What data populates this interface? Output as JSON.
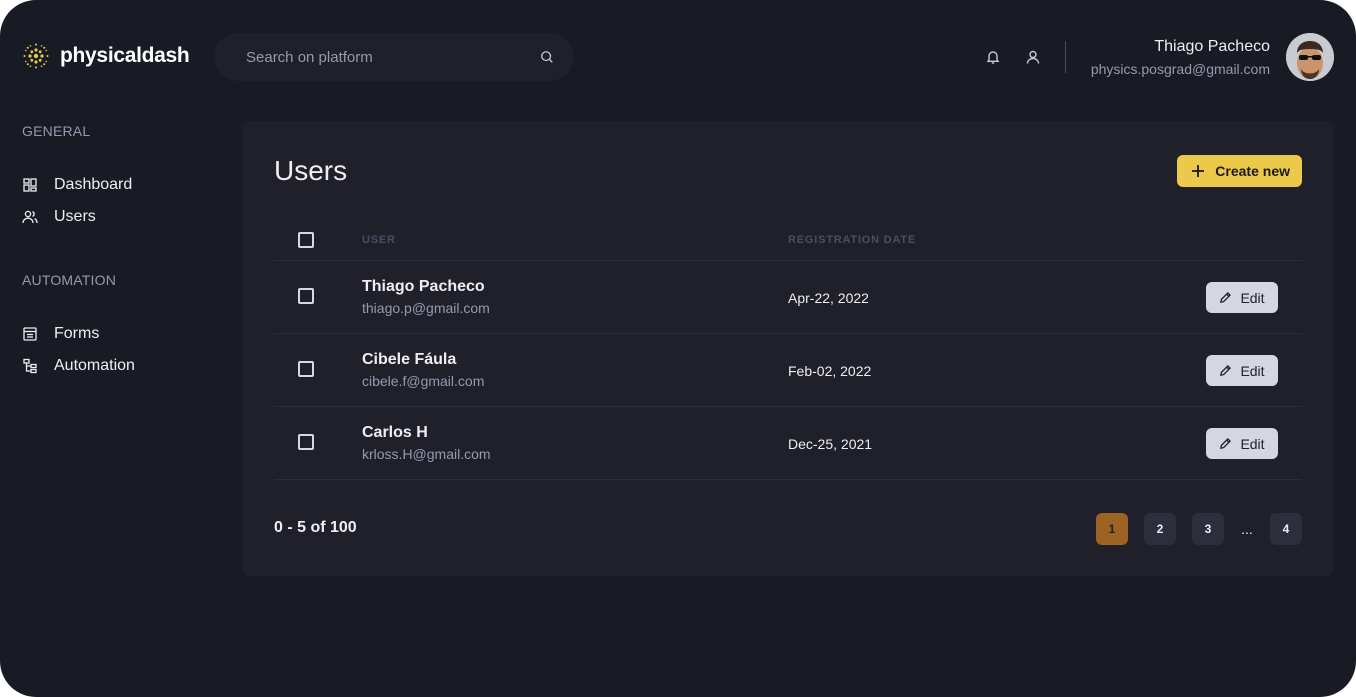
{
  "colors": {
    "background": "#181b23",
    "panel": "#1f2029",
    "accent": "#ecc94b",
    "active_page": "#9c6322",
    "muted_text": "#9699b0",
    "header_text": "#4b4d63"
  },
  "brand": {
    "name": "physicaldash",
    "icon": "sun-dots-logo"
  },
  "search": {
    "placeholder": "Search on platform",
    "value": "",
    "icon": "search-icon"
  },
  "header_icons": [
    "bell-icon",
    "user-icon"
  ],
  "profile": {
    "name": "Thiago Pacheco",
    "email": "physics.posgrad@gmail.com"
  },
  "sidebar": {
    "sections": [
      {
        "title": "GENERAL",
        "items": [
          {
            "label": "Dashboard",
            "icon": "dashboard-icon"
          },
          {
            "label": "Users",
            "icon": "users-icon"
          }
        ]
      },
      {
        "title": "AUTOMATION",
        "items": [
          {
            "label": "Forms",
            "icon": "forms-icon"
          },
          {
            "label": "Automation",
            "icon": "automation-icon"
          }
        ]
      }
    ]
  },
  "main": {
    "title": "Users",
    "create_label": "Create new",
    "columns": [
      "USER",
      "REGISTRATION DATE"
    ],
    "edit_label": "Edit",
    "rows": [
      {
        "name": "Thiago Pacheco",
        "email": "thiago.p@gmail.com",
        "date": "Apr-22, 2022"
      },
      {
        "name": "Cibele Fáula",
        "email": "cibele.f@gmail.com",
        "date": "Feb-02, 2022"
      },
      {
        "name": "Carlos H",
        "email": "krloss.H@gmail.com",
        "date": "Dec-25, 2021"
      }
    ],
    "pagination": {
      "range": "0 - 5 of 100",
      "pages": [
        "1",
        "2",
        "3",
        "...",
        "4"
      ],
      "current": "1"
    }
  }
}
